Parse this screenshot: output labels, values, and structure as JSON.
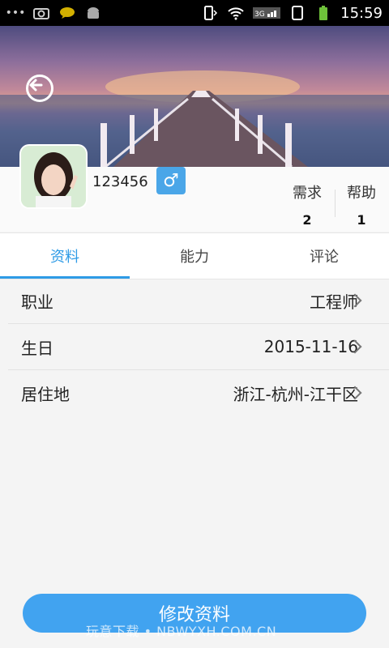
{
  "status_bar": {
    "time": "15:59",
    "left_icons": [
      "more-dots-icon",
      "camera-icon",
      "message-icon",
      "android-icon"
    ],
    "right_icons": [
      "vibrate-icon",
      "wifi-icon",
      "signal-3g-icon",
      "sim-icon",
      "battery-icon"
    ]
  },
  "profile": {
    "username": "123456",
    "gender_symbol": "♂",
    "stats": [
      {
        "label": "需求",
        "value": "2"
      },
      {
        "label": "帮助",
        "value": "1"
      }
    ]
  },
  "tabs": [
    {
      "label": "资料",
      "active": true
    },
    {
      "label": "能力",
      "active": false
    },
    {
      "label": "评论",
      "active": false
    }
  ],
  "details": [
    {
      "label": "职业",
      "value": "工程师"
    },
    {
      "label": "生日",
      "value": "2015-11-16"
    },
    {
      "label": "居住地",
      "value": "浙江-杭州-江干区"
    }
  ],
  "edit_button": {
    "label": "修改资料"
  },
  "watermark": "玩意下载 • NBWYXH.COM.CN",
  "colors": {
    "accent": "#2e9be6",
    "button": "#41a3f0",
    "gender_badge": "#4aa6e8"
  }
}
